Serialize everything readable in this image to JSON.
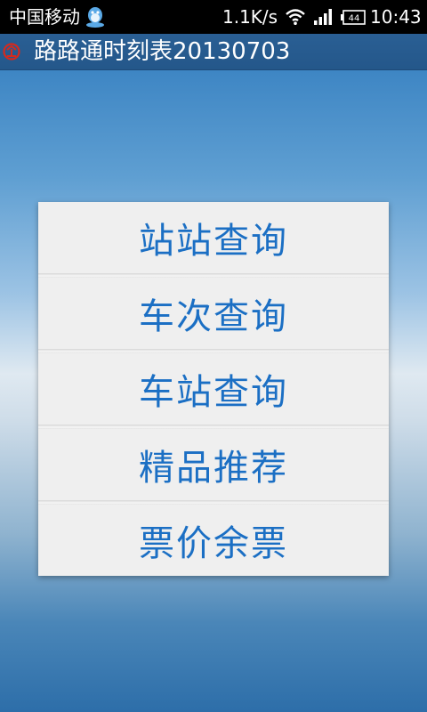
{
  "status_bar": {
    "carrier": "中国移动",
    "net_speed": "1.1K/s",
    "battery_level": "44",
    "time": "10:43",
    "icons": [
      "qq-icon",
      "wifi-icon",
      "signal-icon",
      "battery-icon"
    ]
  },
  "title_bar": {
    "title": "路路通时刻表20130703",
    "icon": "railway-logo-icon"
  },
  "menu": {
    "items": [
      {
        "label": "站站查询"
      },
      {
        "label": "车次查询"
      },
      {
        "label": "车站查询"
      },
      {
        "label": "精品推荐"
      },
      {
        "label": "票价余票"
      }
    ]
  },
  "colors": {
    "menu_text": "#1b6fc4",
    "title_bar": "#2a5f94",
    "logo": "#d42a1e"
  }
}
